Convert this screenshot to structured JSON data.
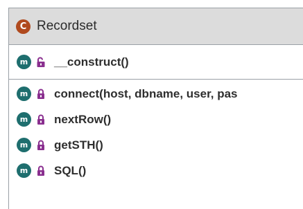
{
  "class": {
    "badge": "C",
    "name": "Recordset"
  },
  "constructor": {
    "badge": "m",
    "name": "__construct()",
    "visibility_icon": "lock-open-icon"
  },
  "methods": [
    {
      "badge": "m",
      "name": "connect(host, dbname, user, pas",
      "visibility_icon": "lock-icon"
    },
    {
      "badge": "m",
      "name": "nextRow()",
      "visibility_icon": "lock-icon"
    },
    {
      "badge": "m",
      "name": "getSTH()",
      "visibility_icon": "lock-icon"
    },
    {
      "badge": "m",
      "name": "SQL()",
      "visibility_icon": "lock-icon"
    }
  ],
  "colors": {
    "class_badge": "#b04a1e",
    "method_badge": "#1e6e6e",
    "lock_icon": "#8a2f8f"
  }
}
